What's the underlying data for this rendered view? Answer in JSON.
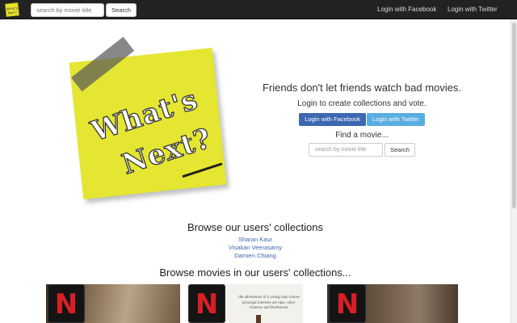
{
  "navbar": {
    "logo_text": "What's Next?",
    "search_placeholder": "search by movie title",
    "search_button": "Search",
    "login_facebook": "Login with Facebook",
    "login_twitter": "Login with Twitter"
  },
  "hero": {
    "logo_line1": "What's",
    "logo_line2": "Next?",
    "tagline": "Friends don't let friends watch bad movies.",
    "subline": "Login to create collections and vote.",
    "login_facebook": "Login with Facebook",
    "login_twitter": "Login with Twitter",
    "find_label": "Find a movie...",
    "search_placeholder": "search by movie title",
    "search_button": "Search"
  },
  "collections": {
    "title": "Browse our users' collections",
    "users": [
      "Sharan Kaur",
      "Visakan Veerasamy",
      "Damien Chiang"
    ]
  },
  "movies": {
    "title": "Browse movies in our users' collections...",
    "badge_letter": "N",
    "tile2_text": "the adventures of a young man whose principal interests are rape, ultra-violence and Beethoven."
  },
  "colors": {
    "navbar": "#222222",
    "facebook": "#3b68b0",
    "twitter": "#59aee0",
    "link": "#3b67b0",
    "note": "#e4e631",
    "netflix_red": "#d81f26"
  }
}
